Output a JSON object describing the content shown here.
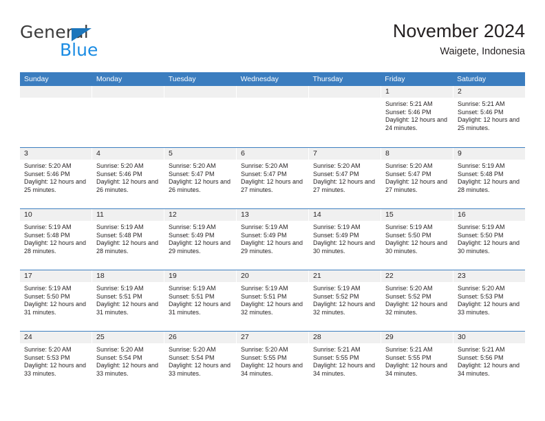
{
  "logo": {
    "word_top": "General",
    "word_bottom": "Blue",
    "triangle_color": "#1b75bb",
    "blue_color": "#1b8ce3"
  },
  "header": {
    "title": "November 2024",
    "subtitle": "Waigete, Indonesia"
  },
  "theme": {
    "header_bg": "#3b7dbf",
    "header_text": "#ffffff",
    "daynum_bg": "#f0f0f0",
    "cell_bg": "#ffffff",
    "text": "#231f20"
  },
  "weekdays": [
    "Sunday",
    "Monday",
    "Tuesday",
    "Wednesday",
    "Thursday",
    "Friday",
    "Saturday"
  ],
  "labels": {
    "sunrise_prefix": "Sunrise:",
    "sunset_prefix": "Sunset:",
    "daylight_prefix": "Daylight:"
  },
  "weeks": [
    [
      {
        "day": "",
        "sunrise": "",
        "sunset": "",
        "daylight": ""
      },
      {
        "day": "",
        "sunrise": "",
        "sunset": "",
        "daylight": ""
      },
      {
        "day": "",
        "sunrise": "",
        "sunset": "",
        "daylight": ""
      },
      {
        "day": "",
        "sunrise": "",
        "sunset": "",
        "daylight": ""
      },
      {
        "day": "",
        "sunrise": "",
        "sunset": "",
        "daylight": ""
      },
      {
        "day": "1",
        "sunrise": "Sunrise: 5:21 AM",
        "sunset": "Sunset: 5:46 PM",
        "daylight": "Daylight: 12 hours and 24 minutes."
      },
      {
        "day": "2",
        "sunrise": "Sunrise: 5:21 AM",
        "sunset": "Sunset: 5:46 PM",
        "daylight": "Daylight: 12 hours and 25 minutes."
      }
    ],
    [
      {
        "day": "3",
        "sunrise": "Sunrise: 5:20 AM",
        "sunset": "Sunset: 5:46 PM",
        "daylight": "Daylight: 12 hours and 25 minutes."
      },
      {
        "day": "4",
        "sunrise": "Sunrise: 5:20 AM",
        "sunset": "Sunset: 5:46 PM",
        "daylight": "Daylight: 12 hours and 26 minutes."
      },
      {
        "day": "5",
        "sunrise": "Sunrise: 5:20 AM",
        "sunset": "Sunset: 5:47 PM",
        "daylight": "Daylight: 12 hours and 26 minutes."
      },
      {
        "day": "6",
        "sunrise": "Sunrise: 5:20 AM",
        "sunset": "Sunset: 5:47 PM",
        "daylight": "Daylight: 12 hours and 27 minutes."
      },
      {
        "day": "7",
        "sunrise": "Sunrise: 5:20 AM",
        "sunset": "Sunset: 5:47 PM",
        "daylight": "Daylight: 12 hours and 27 minutes."
      },
      {
        "day": "8",
        "sunrise": "Sunrise: 5:20 AM",
        "sunset": "Sunset: 5:47 PM",
        "daylight": "Daylight: 12 hours and 27 minutes."
      },
      {
        "day": "9",
        "sunrise": "Sunrise: 5:19 AM",
        "sunset": "Sunset: 5:48 PM",
        "daylight": "Daylight: 12 hours and 28 minutes."
      }
    ],
    [
      {
        "day": "10",
        "sunrise": "Sunrise: 5:19 AM",
        "sunset": "Sunset: 5:48 PM",
        "daylight": "Daylight: 12 hours and 28 minutes."
      },
      {
        "day": "11",
        "sunrise": "Sunrise: 5:19 AM",
        "sunset": "Sunset: 5:48 PM",
        "daylight": "Daylight: 12 hours and 28 minutes."
      },
      {
        "day": "12",
        "sunrise": "Sunrise: 5:19 AM",
        "sunset": "Sunset: 5:49 PM",
        "daylight": "Daylight: 12 hours and 29 minutes."
      },
      {
        "day": "13",
        "sunrise": "Sunrise: 5:19 AM",
        "sunset": "Sunset: 5:49 PM",
        "daylight": "Daylight: 12 hours and 29 minutes."
      },
      {
        "day": "14",
        "sunrise": "Sunrise: 5:19 AM",
        "sunset": "Sunset: 5:49 PM",
        "daylight": "Daylight: 12 hours and 30 minutes."
      },
      {
        "day": "15",
        "sunrise": "Sunrise: 5:19 AM",
        "sunset": "Sunset: 5:50 PM",
        "daylight": "Daylight: 12 hours and 30 minutes."
      },
      {
        "day": "16",
        "sunrise": "Sunrise: 5:19 AM",
        "sunset": "Sunset: 5:50 PM",
        "daylight": "Daylight: 12 hours and 30 minutes."
      }
    ],
    [
      {
        "day": "17",
        "sunrise": "Sunrise: 5:19 AM",
        "sunset": "Sunset: 5:50 PM",
        "daylight": "Daylight: 12 hours and 31 minutes."
      },
      {
        "day": "18",
        "sunrise": "Sunrise: 5:19 AM",
        "sunset": "Sunset: 5:51 PM",
        "daylight": "Daylight: 12 hours and 31 minutes."
      },
      {
        "day": "19",
        "sunrise": "Sunrise: 5:19 AM",
        "sunset": "Sunset: 5:51 PM",
        "daylight": "Daylight: 12 hours and 31 minutes."
      },
      {
        "day": "20",
        "sunrise": "Sunrise: 5:19 AM",
        "sunset": "Sunset: 5:51 PM",
        "daylight": "Daylight: 12 hours and 32 minutes."
      },
      {
        "day": "21",
        "sunrise": "Sunrise: 5:19 AM",
        "sunset": "Sunset: 5:52 PM",
        "daylight": "Daylight: 12 hours and 32 minutes."
      },
      {
        "day": "22",
        "sunrise": "Sunrise: 5:20 AM",
        "sunset": "Sunset: 5:52 PM",
        "daylight": "Daylight: 12 hours and 32 minutes."
      },
      {
        "day": "23",
        "sunrise": "Sunrise: 5:20 AM",
        "sunset": "Sunset: 5:53 PM",
        "daylight": "Daylight: 12 hours and 33 minutes."
      }
    ],
    [
      {
        "day": "24",
        "sunrise": "Sunrise: 5:20 AM",
        "sunset": "Sunset: 5:53 PM",
        "daylight": "Daylight: 12 hours and 33 minutes."
      },
      {
        "day": "25",
        "sunrise": "Sunrise: 5:20 AM",
        "sunset": "Sunset: 5:54 PM",
        "daylight": "Daylight: 12 hours and 33 minutes."
      },
      {
        "day": "26",
        "sunrise": "Sunrise: 5:20 AM",
        "sunset": "Sunset: 5:54 PM",
        "daylight": "Daylight: 12 hours and 33 minutes."
      },
      {
        "day": "27",
        "sunrise": "Sunrise: 5:20 AM",
        "sunset": "Sunset: 5:55 PM",
        "daylight": "Daylight: 12 hours and 34 minutes."
      },
      {
        "day": "28",
        "sunrise": "Sunrise: 5:21 AM",
        "sunset": "Sunset: 5:55 PM",
        "daylight": "Daylight: 12 hours and 34 minutes."
      },
      {
        "day": "29",
        "sunrise": "Sunrise: 5:21 AM",
        "sunset": "Sunset: 5:55 PM",
        "daylight": "Daylight: 12 hours and 34 minutes."
      },
      {
        "day": "30",
        "sunrise": "Sunrise: 5:21 AM",
        "sunset": "Sunset: 5:56 PM",
        "daylight": "Daylight: 12 hours and 34 minutes."
      }
    ]
  ]
}
